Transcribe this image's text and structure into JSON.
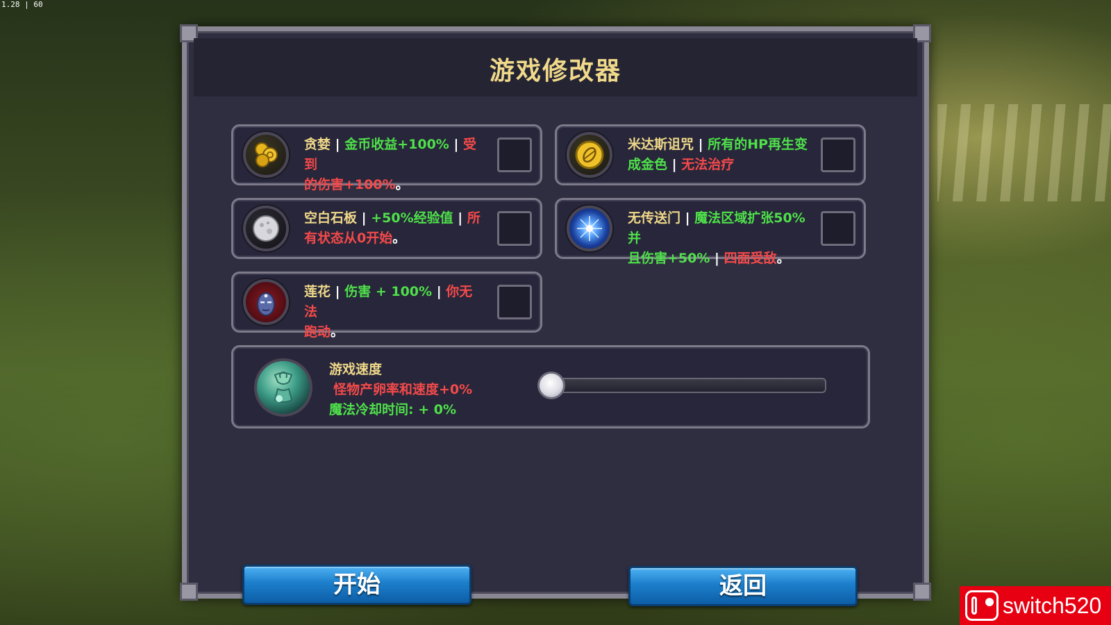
{
  "fps_counter": "1.28 | 60",
  "dialog": {
    "title": "游戏修改器"
  },
  "modifiers": [
    {
      "icon": "gold-coins-icon",
      "name": "贪婪",
      "good": "金币收益+100%",
      "bad1": "受到",
      "bad2": "的伤害+100%",
      "tail": "。",
      "checked": false
    },
    {
      "icon": "midas-coin-icon",
      "name": "米达斯诅咒",
      "good1": "所有的HP再生变",
      "good2": "成金色",
      "bad": "无法治疗",
      "checked": false
    },
    {
      "icon": "blank-slate-icon",
      "name": "空白石板",
      "good": "+50%经验值",
      "bad1": "所",
      "bad2": "有状态从0开始",
      "tail": "。",
      "checked": false
    },
    {
      "icon": "portal-icon",
      "name": "无传送门",
      "good1": "魔法区域扩张50%并",
      "good2": "且伤害+50%",
      "bad": "四面受敌",
      "tail": "。",
      "checked": false
    },
    {
      "icon": "lotus-face-icon",
      "name": "莲花",
      "good": "伤害 + 100%",
      "bad1": "你无法",
      "bad2": "跑动",
      "tail": "。",
      "checked": false
    }
  ],
  "separator": "|",
  "game_speed": {
    "label": "游戏速度",
    "spawn": "怪物产卵率和速度+0%",
    "cooldown": "魔法冷却时间: + 0%",
    "slider_value": 0
  },
  "buttons": {
    "start": "开始",
    "back": "返回"
  },
  "watermark": "switch520",
  "colors": {
    "name": "#f0d98a",
    "good": "#4fe04a",
    "bad": "#f44a4a",
    "button": "#1c7ecb"
  }
}
